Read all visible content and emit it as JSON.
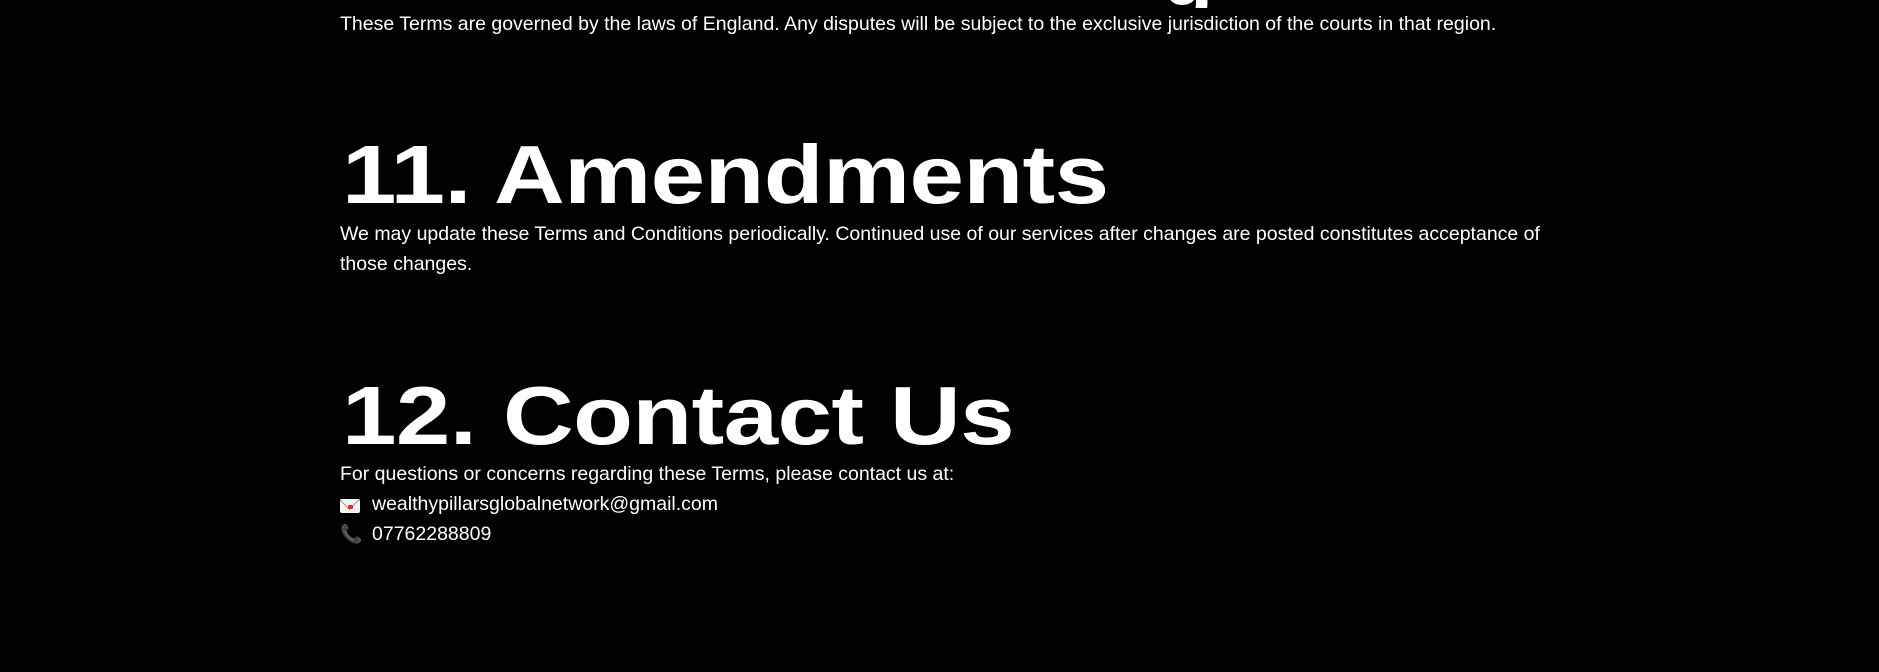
{
  "previous_section": {
    "heading_fragment": "g",
    "text": "These Terms are governed by the laws of England. Any disputes will be subject to the exclusive jurisdiction of the courts in that region."
  },
  "amendments": {
    "heading": "11. Amendments",
    "text": "We may update these Terms and Conditions periodically. Continued use of our services after changes are posted constitutes acceptance of those changes."
  },
  "contact": {
    "heading": "12. Contact Us",
    "intro": "For questions or concerns regarding these Terms, please contact us at:",
    "email_icon": "envelope-icon",
    "email": "wealthypillarsglobalnetwork@gmail.com",
    "phone_icon": "phone-icon",
    "phone": "07762288809",
    "phone_icon_color": "#e02a2a"
  },
  "colors": {
    "background": "#000000",
    "text": "#ffffff"
  }
}
